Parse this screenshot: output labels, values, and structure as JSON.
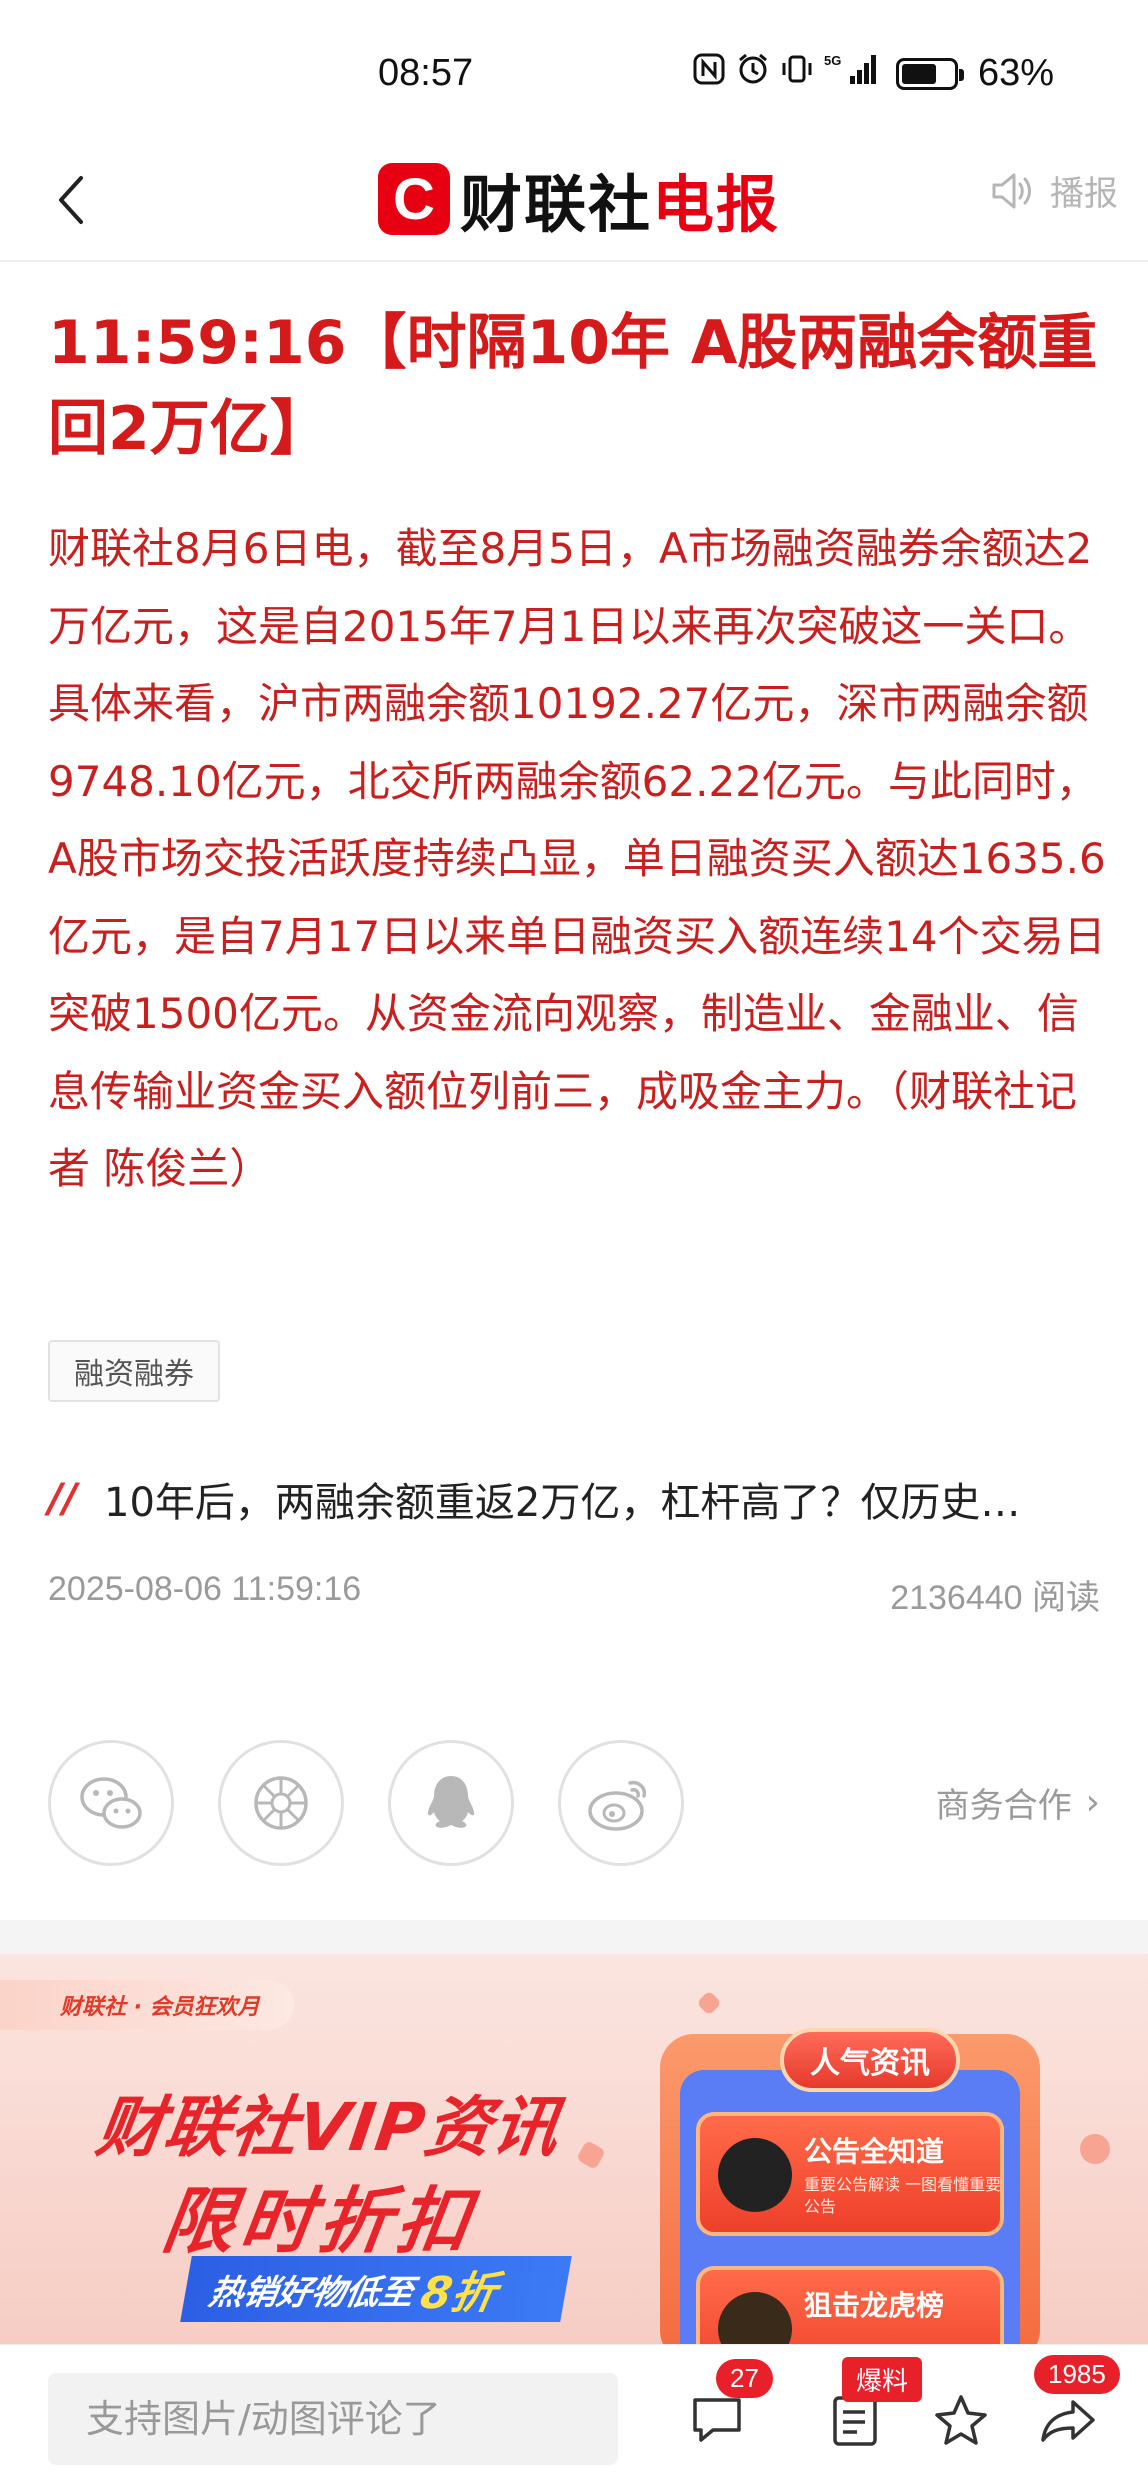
{
  "status_bar": {
    "time": "08:57",
    "network": "5G",
    "battery": "63%",
    "battery_level": 0.63
  },
  "header": {
    "logo_mark": "C",
    "logo_text_a": "财联社",
    "logo_text_b": "电报",
    "broadcast_label": "播报"
  },
  "article": {
    "title": "11:59:16【时隔10年 A股两融余额重回2万亿】",
    "body": "财联社8月6日电，截至8月5日，A市场融资融券余额达2万亿元，这是自2015年7月1日以来再次突破这一关口。具体来看，沪市两融余额10192.27亿元，深市两融余额9748.10亿元，北交所两融余额62.22亿元。与此同时，A股市场交投活跃度持续凸显，单日融资买入额达1635.6亿元，是自7月17日以来单日融资买入额连续14个交易日突破1500亿元。从资金流向观察，制造业、金融业、信息传输业资金买入额位列前三，成吸金主力。（财联社记者 陈俊兰）",
    "tag": "融资融券",
    "related_title": "10年后，两融余额重返2万亿，杠杆高了？仅历史…",
    "timestamp": "2025-08-06 11:59:16",
    "reads": "2136440 阅读"
  },
  "share": {
    "icons": [
      "wechat-icon",
      "moments-icon",
      "qq-icon",
      "weibo-icon"
    ],
    "business_label": "商务合作"
  },
  "banner": {
    "tag": "财联社 · 会员狂欢月",
    "headline": "财联社VIP资讯",
    "subheadline": "限时折扣",
    "strip_text": "热销好物低至",
    "strip_highlight": "8折",
    "panel_title": "人气资讯",
    "card1_title": "公告全知道",
    "card1_sub": "重要公告解读 一图看懂重要公告",
    "card2_title": "狙击龙虎榜"
  },
  "bottom_bar": {
    "comment_placeholder": "支持图片/动图评论了",
    "comment_count": "27",
    "report_badge": "爆料",
    "share_count": "1985"
  },
  "colors": {
    "brand_red": "#e60012",
    "title_red": "#d41a1a",
    "body_red": "#c81f1f"
  }
}
